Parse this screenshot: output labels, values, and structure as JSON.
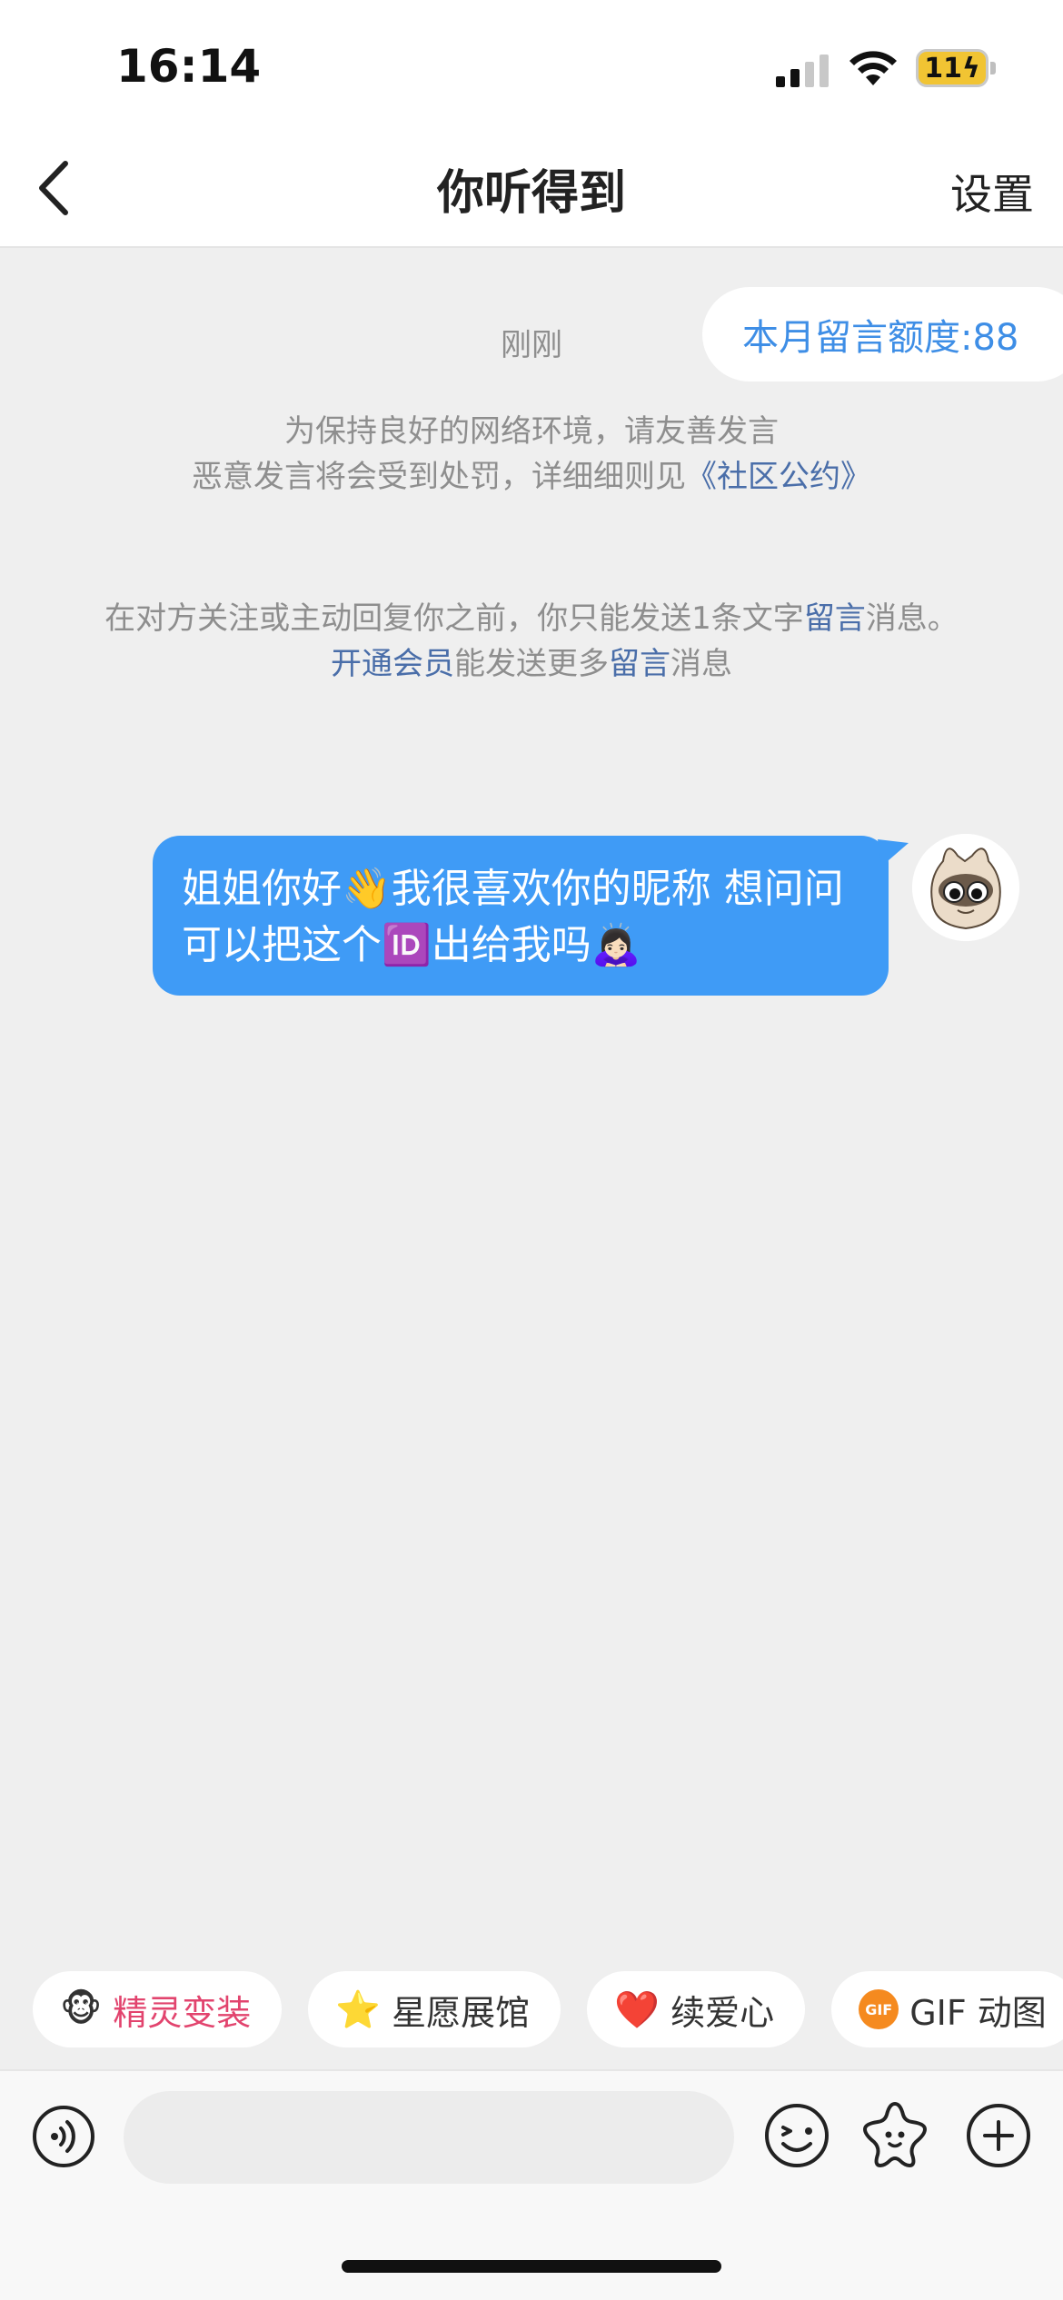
{
  "status_bar": {
    "time": "16:14",
    "battery": "11"
  },
  "header": {
    "title": "你听得到",
    "settings_label": "设置",
    "back_icon": "chevron-left-icon"
  },
  "quota": {
    "label": "本月留言额度:88"
  },
  "timestamp": "刚刚",
  "notice_1": {
    "line1": "为保持良好的网络环境，请友善发言",
    "line2_prefix": "恶意发言将会受到处罚，详细细则见",
    "line2_link": "《社区公约》"
  },
  "notice_2": {
    "part1": "在对方关注或主动回复你之前，你只能发送1条文字",
    "link1": "留言",
    "part2": "消息。",
    "link2": "开通会员",
    "part3": "能发送更多",
    "link3": "留言",
    "part4": "消息"
  },
  "message": {
    "text": "姐姐你好👋我很喜欢你的昵称 想问问可以把这个🆔出给我吗🙇🏻‍♀️",
    "bubble_color": "#3f9bf6"
  },
  "chips": [
    {
      "icon": "🐵",
      "label": "精灵变装"
    },
    {
      "icon": "⭐",
      "label": "星愿展馆"
    },
    {
      "icon": "❤️",
      "label": "续爱心"
    },
    {
      "icon": "GIF",
      "label": "GIF 动图"
    }
  ],
  "input": {
    "placeholder": ""
  },
  "colors": {
    "accent": "#3e8ee6",
    "link": "#4a6ea9",
    "pink": "#e2446e",
    "background": "#efefef"
  }
}
